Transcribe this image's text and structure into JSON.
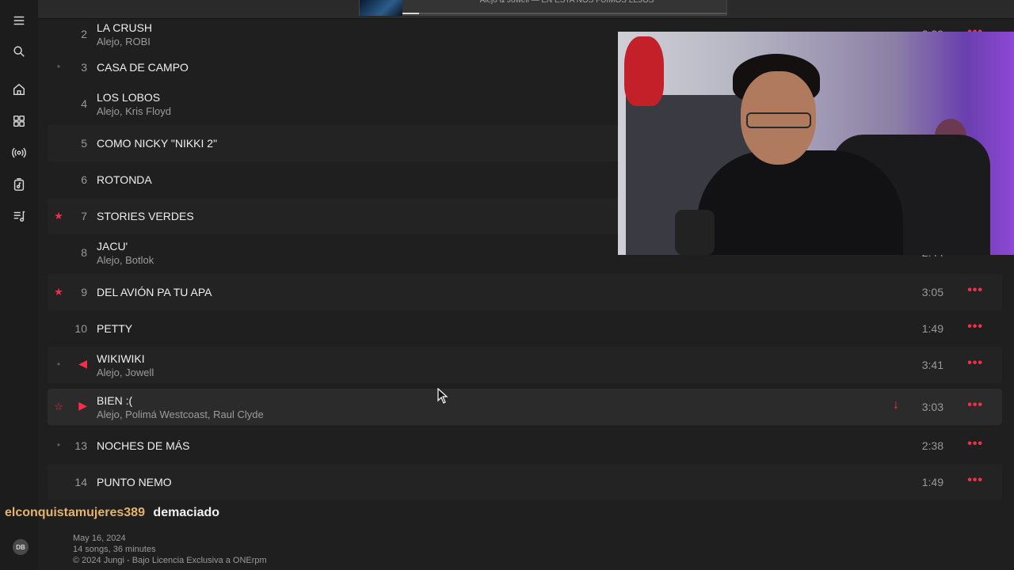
{
  "now_playing": {
    "text": "Alejo & Jowell — EN ESTA NOS FUIMOS LEJOS",
    "progress": 0.05
  },
  "nav": [
    {
      "name": "menu-icon"
    },
    {
      "name": "search-icon"
    },
    {
      "name": "home-icon"
    },
    {
      "name": "grid-icon"
    },
    {
      "name": "radio-icon"
    },
    {
      "name": "library-icon"
    },
    {
      "name": "playlist-icon"
    }
  ],
  "tracks": [
    {
      "num": "2",
      "title": "LA CRUSH",
      "artist": "Alejo, ROBI",
      "duration": "3:29",
      "lead": ""
    },
    {
      "num": "3",
      "title": "CASA DE CAMPO",
      "artist": "",
      "duration": "",
      "lead": "•"
    },
    {
      "num": "4",
      "title": "LOS LOBOS",
      "artist": "Alejo, Kris Floyd",
      "duration": "",
      "lead": ""
    },
    {
      "num": "5",
      "title": "COMO NICKY \"NIKKI 2\"",
      "artist": "",
      "duration": "",
      "lead": ""
    },
    {
      "num": "6",
      "title": "ROTONDA",
      "artist": "",
      "duration": "",
      "lead": ""
    },
    {
      "num": "7",
      "title": "STORIES VERDES",
      "artist": "",
      "duration": "",
      "lead": "★"
    },
    {
      "num": "8",
      "title": "JACU'",
      "artist": "Alejo, Botlok",
      "duration": "2:44",
      "lead": ""
    },
    {
      "num": "9",
      "title": "DEL AVIÓN PA TU APA",
      "artist": "",
      "duration": "3:05",
      "lead": "★"
    },
    {
      "num": "10",
      "title": "PETTY",
      "artist": "",
      "duration": "1:49",
      "lead": ""
    },
    {
      "num": "",
      "title": "WIKIWIKI",
      "artist": "Alejo, Jowell",
      "duration": "3:41",
      "lead": "•"
    },
    {
      "num": "",
      "title": "BIEN :(",
      "artist": "Alejo, Polimá Westcoast, Raul Clyde",
      "duration": "3:03",
      "lead": "☆"
    },
    {
      "num": "13",
      "title": "NOCHES DE MÁS",
      "artist": "",
      "duration": "2:38",
      "lead": "•"
    },
    {
      "num": "14",
      "title": "PUNTO NEMO",
      "artist": "",
      "duration": "1:49",
      "lead": ""
    }
  ],
  "more_glyph": "•••",
  "chat": {
    "user": "elconquistamujeres389",
    "message": "demaciado"
  },
  "footer": {
    "avatar": "DB",
    "date": "May 16, 2024",
    "summary": "14 songs, 36 minutes",
    "copyright": "© 2024 Jungi - Bajo Licencia Exclusiva a ONErpm"
  },
  "colors": {
    "accent": "#fa2d48",
    "background": "#1f1f1f",
    "chat_user": "#e6b36a"
  }
}
